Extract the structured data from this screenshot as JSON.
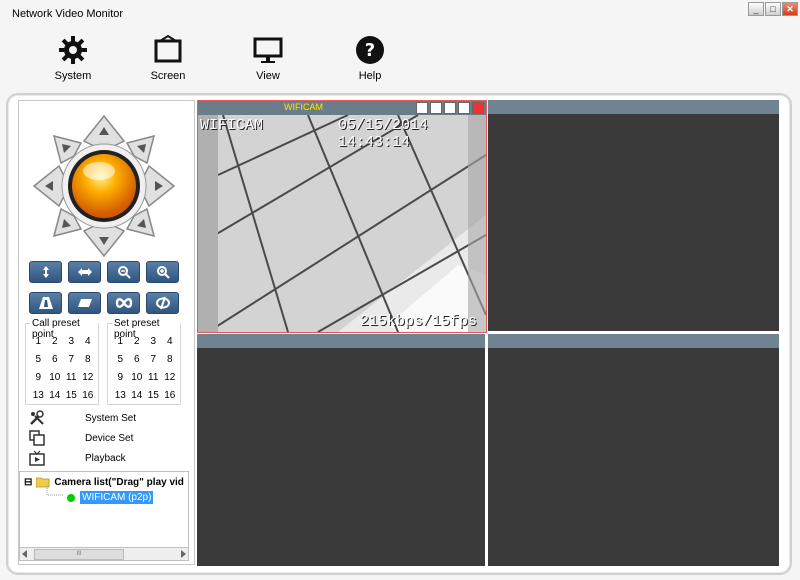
{
  "window": {
    "title": "Network Video Monitor",
    "min_icon": "minimize-icon",
    "max_icon": "maximize-icon",
    "close_icon": "close-icon",
    "min_glyph": "_",
    "max_glyph": "□",
    "close_glyph": "✕"
  },
  "toolbar": {
    "system_label": "System",
    "screen_label": "Screen",
    "view_label": "View",
    "help_label": "Help"
  },
  "ptz": {
    "center_color": "#ff8c00",
    "buttons": [
      "vertical-flip",
      "horizontal-flip",
      "zoom-out",
      "zoom-in",
      "focus-far",
      "focus-near",
      "cruise",
      "stop"
    ]
  },
  "presets": {
    "call_title": "Call preset point",
    "set_title": "Set preset point",
    "numbers": [
      "1",
      "2",
      "3",
      "4",
      "5",
      "6",
      "7",
      "8",
      "9",
      "10",
      "11",
      "12",
      "13",
      "14",
      "15",
      "16"
    ]
  },
  "menu": {
    "system_set": "System Set",
    "device_set": "Device Set",
    "playback": "Playback"
  },
  "tree": {
    "root_label": "Camera list(\"Drag\" play vid",
    "camera_label": "WIFICAM (p2p)",
    "expand_glyph": "⊟",
    "scroll_mid": "III"
  },
  "video": {
    "camera_name": "WIFICAM",
    "osd_name": "WIFICAM",
    "osd_datetime": "05/15/2014 14:43:14",
    "osd_rate": "215kbps/15fps"
  },
  "colors": {
    "title_accent": "#ffe600",
    "selected_border": "#e35a5a",
    "online_dot": "#00cc00",
    "selection": "#3399ff"
  }
}
